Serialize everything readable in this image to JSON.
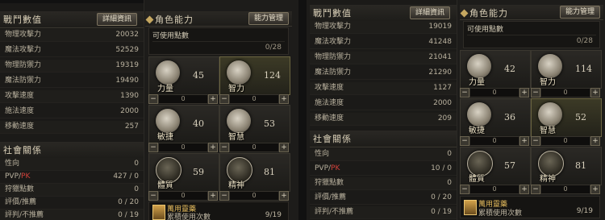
{
  "panels": [
    {
      "combat": {
        "title": "戰鬥數值",
        "detail_button": "詳細資訊",
        "stats": [
          {
            "label": "物理攻擊力",
            "value": "20032"
          },
          {
            "label": "魔法攻擊力",
            "value": "52529"
          },
          {
            "label": "物理防禦力",
            "value": "19319"
          },
          {
            "label": "魔法防禦力",
            "value": "19490"
          },
          {
            "label": "攻擊速度",
            "value": "1390"
          },
          {
            "label": "施法速度",
            "value": "2000"
          },
          {
            "label": "移動速度",
            "value": "257"
          }
        ]
      },
      "social": {
        "title": "社會關係",
        "rows": [
          {
            "label": "性向",
            "value": "0"
          },
          {
            "label": "PVP/",
            "pk": "PK",
            "value": "427 / 0"
          },
          {
            "label": "狩獵點數",
            "value": "0"
          },
          {
            "label": "評價/推薦",
            "value": "0 / 20"
          },
          {
            "label": "評判/不推薦",
            "value": "0 / 19"
          }
        ]
      },
      "ability": {
        "title": "角色能力",
        "manage_button": "能力管理",
        "available_label": "可使用點數",
        "available_value": "0/28",
        "attrs": [
          {
            "name": "力量",
            "value": "45",
            "alloc": "0"
          },
          {
            "name": "智力",
            "value": "124",
            "alloc": "0"
          },
          {
            "name": "敏捷",
            "value": "40",
            "alloc": "0"
          },
          {
            "name": "智慧",
            "value": "53",
            "alloc": "0"
          },
          {
            "name": "體質",
            "value": "59",
            "alloc": "0"
          },
          {
            "name": "精神",
            "value": "81",
            "alloc": "0"
          }
        ],
        "title_card": {
          "name": "萬用靈藥",
          "desc": "累積使用次數",
          "count": "9/19"
        }
      }
    },
    {
      "combat": {
        "title": "戰鬥數值",
        "detail_button": "詳細資訊",
        "stats": [
          {
            "label": "物理攻擊力",
            "value": "19019"
          },
          {
            "label": "魔法攻擊力",
            "value": "41248"
          },
          {
            "label": "物理防禦力",
            "value": "21041"
          },
          {
            "label": "魔法防禦力",
            "value": "21290"
          },
          {
            "label": "攻擊速度",
            "value": "1127"
          },
          {
            "label": "施法速度",
            "value": "2000"
          },
          {
            "label": "移動速度",
            "value": "209"
          }
        ]
      },
      "social": {
        "title": "社會關係",
        "rows": [
          {
            "label": "性向",
            "value": "0"
          },
          {
            "label": "PVP/",
            "pk": "PK",
            "value": "10 / 0"
          },
          {
            "label": "狩獵點數",
            "value": "0"
          },
          {
            "label": "評價/推薦",
            "value": "0 / 20"
          },
          {
            "label": "評判/不推薦",
            "value": "0 / 19"
          }
        ]
      },
      "ability": {
        "title": "角色能力",
        "manage_button": "能力管理",
        "available_label": "可使用點數",
        "available_value": "0/28",
        "attrs": [
          {
            "name": "力量",
            "value": "42",
            "alloc": "0"
          },
          {
            "name": "智力",
            "value": "114",
            "alloc": "0"
          },
          {
            "name": "敏捷",
            "value": "36",
            "alloc": "0"
          },
          {
            "name": "智慧",
            "value": "52",
            "alloc": "0"
          },
          {
            "name": "體質",
            "value": "57",
            "alloc": "0"
          },
          {
            "name": "精神",
            "value": "81",
            "alloc": "0"
          }
        ],
        "title_card": {
          "name": "萬用靈藥",
          "desc": "累積使用次數",
          "count": "9/19"
        }
      }
    }
  ],
  "colors": {
    "pk": "#d0413a",
    "title_gold": "#e2b95c",
    "highlight": "#6a6440"
  }
}
